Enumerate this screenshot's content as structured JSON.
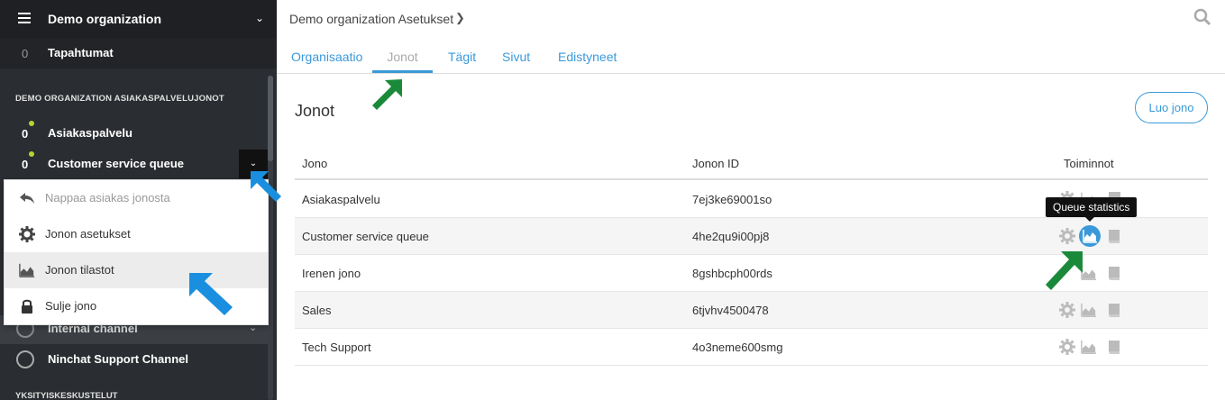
{
  "sidebar": {
    "org_title": "Demo organization",
    "events": {
      "count": "0",
      "label": "Tapahtumat"
    },
    "section_heading": "DEMO ORGANIZATION ASIAKASPALVELUJONOT",
    "queues": [
      {
        "count": "0",
        "label": "Asiakaspalvelu"
      },
      {
        "count": "0",
        "label": "Customer service queue"
      }
    ],
    "channels": [
      {
        "label": "Internal channel"
      },
      {
        "label": "Ninchat Support Channel"
      }
    ],
    "private_heading": "YKSITYISKESKUSTELUT"
  },
  "dropdown": {
    "items": [
      {
        "label": "Nappaa asiakas jonosta",
        "icon": "reply-icon"
      },
      {
        "label": "Jonon asetukset",
        "icon": "gear-icon"
      },
      {
        "label": "Jonon tilastot",
        "icon": "chart-icon"
      },
      {
        "label": "Sulje jono",
        "icon": "lock-icon"
      }
    ]
  },
  "main": {
    "header_title": "Demo organization Asetukset",
    "tabs": [
      {
        "label": "Organisaatio"
      },
      {
        "label": "Jonot"
      },
      {
        "label": "Tägit"
      },
      {
        "label": "Sivut"
      },
      {
        "label": "Edistyneet"
      }
    ],
    "heading": "Jonot",
    "create_button": "Luo jono",
    "table": {
      "headers": [
        "Jono",
        "Jonon ID",
        "Toiminnot"
      ],
      "rows": [
        {
          "name": "Asiakaspalvelu",
          "id": "7ej3ke69001so"
        },
        {
          "name": "Customer service queue",
          "id": "4he2qu9i00pj8"
        },
        {
          "name": "Irenen jono",
          "id": "8gshbcph00rds"
        },
        {
          "name": "Sales",
          "id": "6tjvhv4500478"
        },
        {
          "name": "Tech Support",
          "id": "4o3neme600smg"
        }
      ]
    },
    "tooltip": "Queue statistics"
  },
  "colors": {
    "accent": "#3a9ad9",
    "sidebar_bg": "#2a2d31",
    "online_dot": "#b5d334",
    "arrow_green": "#1a8a3a",
    "arrow_blue": "#1a8fe0"
  }
}
